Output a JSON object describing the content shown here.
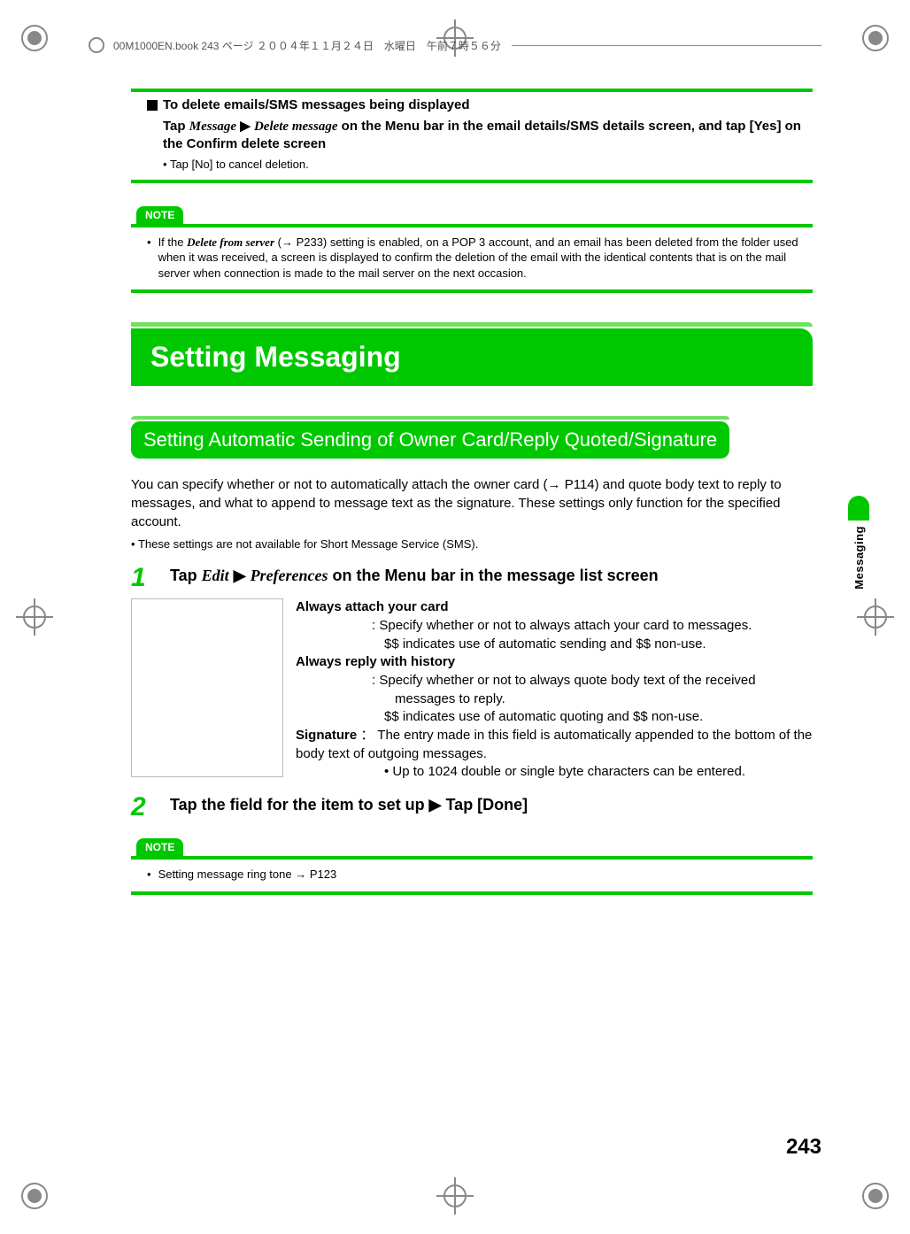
{
  "header": {
    "running": "00M1000EN.book  243 ページ  ２００４年１１月２４日　水曜日　午前７時５６分"
  },
  "delete_block": {
    "heading": "To delete emails/SMS messages being displayed",
    "tap_prefix": "Tap ",
    "menu_message": "Message",
    "menu_delete": "Delete message",
    "tap_suffix": " on the Menu bar in the email details/SMS details screen, and tap [Yes] on the Confirm delete screen",
    "cancel": "Tap [No] to cancel deletion."
  },
  "note1": {
    "label": "NOTE",
    "prefix": "If the ",
    "italic": "Delete from server",
    "rest": " (→ P233) setting is enabled, on a POP 3 account, and an email has been deleted from the folder used when it was received, a screen is displayed to confirm the deletion of the email with the identical contents that is on the mail server when connection is made to the mail server on the next occasion."
  },
  "chapter": "Setting Messaging",
  "section": "Setting Automatic Sending of Owner Card/Reply Quoted/Signature",
  "intro": "You can specify whether or not to automatically attach the owner card (→ P114) and quote body text to reply to messages, and what to append to message text as the signature. These settings only function for the specified account.",
  "intro_note": "These settings are not available for Short Message Service (SMS).",
  "step1": {
    "num": "1",
    "pre": "Tap ",
    "m1": "Edit",
    "m2": "Preferences",
    "post": " on the Menu bar in the message list screen"
  },
  "prefs": {
    "attach_label": "Always attach your card",
    "attach_desc1": "Specify whether or not to always attach your card to messages.",
    "attach_desc2": "$$ indicates use of automatic sending and $$ non-use.",
    "reply_label": "Always reply with history",
    "reply_desc1": "Specify whether or not to always quote body text of the received messages to reply.",
    "reply_desc2": "$$ indicates use of automatic quoting and $$ non-use.",
    "sig_label": "Signature",
    "sig_desc1": "The entry made in this field is automatically appended to the bottom of the body text of outgoing messages.",
    "sig_sub": "Up to 1024 double or single byte characters can be entered."
  },
  "step2": {
    "num": "2",
    "text": "Tap the field for the item to set up ▶ Tap [Done]"
  },
  "note2": {
    "label": "NOTE",
    "text": "Setting message ring tone → P123"
  },
  "side_tab": "Messaging",
  "page_number": "243"
}
